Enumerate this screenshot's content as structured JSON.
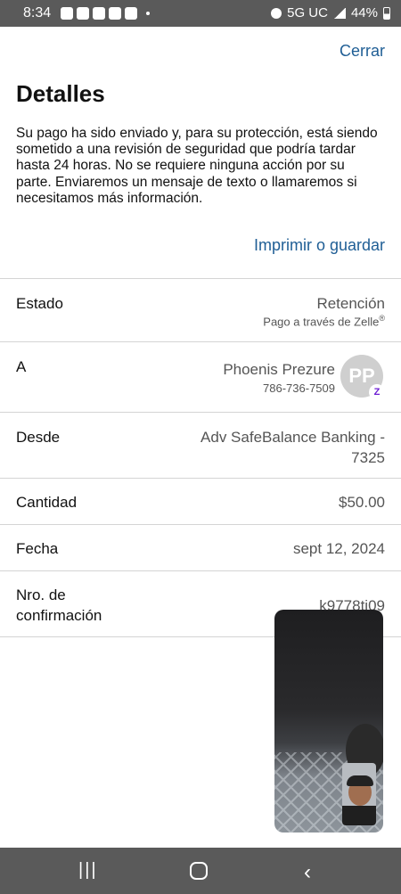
{
  "status_bar": {
    "time": "8:34",
    "network": "5G UC",
    "battery": "44%"
  },
  "header": {
    "close_label": "Cerrar",
    "title": "Detalles"
  },
  "description": "Su pago ha sido enviado y, para su protección, está siendo sometido a una revisión de seguridad que podría tardar hasta 24 horas. No se requiere ninguna acción por su parte. Enviaremos un mensaje de texto o llamaremos si necesitamos más información.",
  "print_label": "Imprimir o guardar",
  "details": {
    "status": {
      "label": "Estado",
      "value": "Retención",
      "sub": "Pago a través de Zelle",
      "sub_mark": "®"
    },
    "to": {
      "label": "A",
      "name": "Phoenis Prezure",
      "phone": "786-736-7509",
      "initials": "PP",
      "badge": "Z"
    },
    "from": {
      "label": "Desde",
      "value_line1": "Adv SafeBalance Banking -",
      "value_line2": "7325"
    },
    "amount": {
      "label": "Cantidad",
      "value": "$50.00"
    },
    "date": {
      "label": "Fecha",
      "value": "sept 12, 2024"
    },
    "confirmation": {
      "label_line1": "Nro. de",
      "label_line2": "confirmación",
      "value": "k9778ti09"
    }
  },
  "nav_bar": {
    "recents_icon": "|||",
    "home_icon": "home-icon",
    "back_icon": "‹"
  }
}
